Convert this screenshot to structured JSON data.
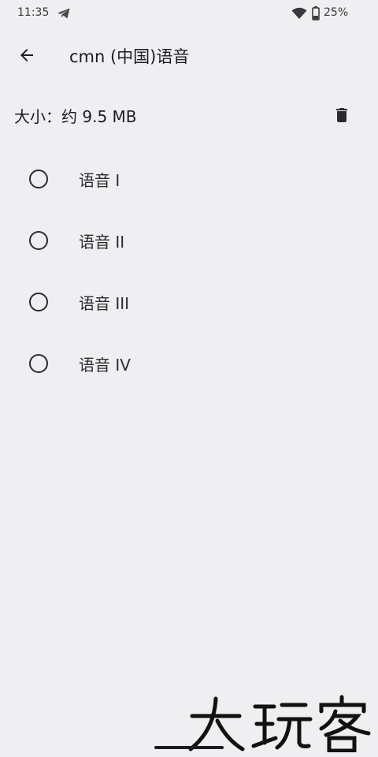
{
  "status_bar": {
    "time": "11:35",
    "battery": "25%",
    "icons": [
      "telegram-icon",
      "wifi-icon",
      "battery-icon"
    ]
  },
  "app_bar": {
    "title": "cmn (中国)语音",
    "back_icon": "arrow-back-icon"
  },
  "size_row": {
    "label": "大小：约 9.5 MB",
    "delete_icon": "trash-icon"
  },
  "voices": [
    {
      "label": "语音 I",
      "selected": false
    },
    {
      "label": "语音 II",
      "selected": false
    },
    {
      "label": "语音 III",
      "selected": false
    },
    {
      "label": "语音 IV",
      "selected": false
    }
  ],
  "watermark": {
    "text": "大玩客"
  },
  "colors": {
    "background": "#efeff2",
    "text": "#1c1b1f",
    "icon": "#2b2b2e"
  }
}
